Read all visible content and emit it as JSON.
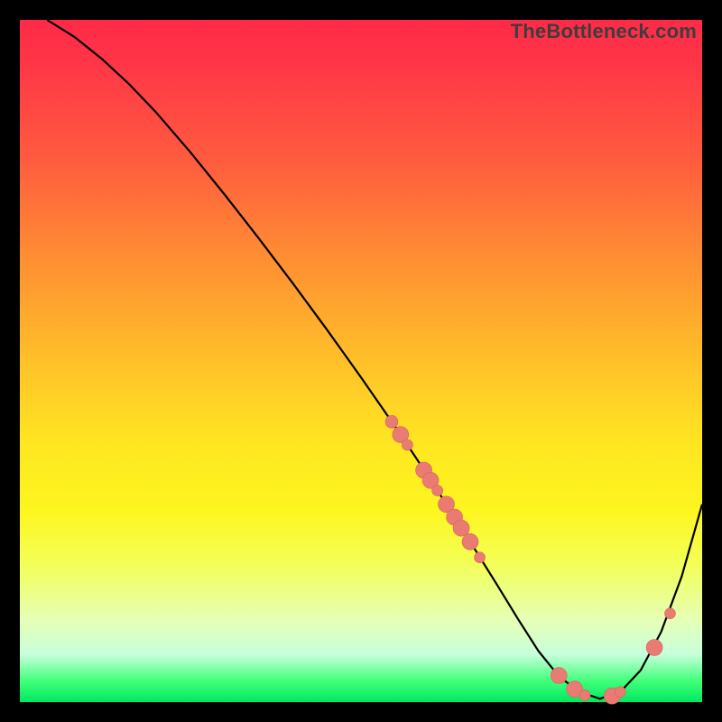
{
  "watermark": "TheBottleneck.com",
  "colors": {
    "gradient_top": "#ff2a47",
    "gradient_bottom": "#00e860",
    "curve": "#000000",
    "dot": "#e97b72"
  },
  "chart_data": {
    "type": "line",
    "title": "",
    "xlabel": "",
    "ylabel": "",
    "xlim": [
      0,
      100
    ],
    "ylim": [
      0,
      100
    ],
    "grid": false,
    "series": [
      {
        "name": "curve",
        "x": [
          4,
          8,
          12,
          16,
          20,
          25,
          30,
          35,
          40,
          45,
          50,
          55,
          58,
          62,
          66,
          70,
          73,
          76,
          79,
          82,
          85,
          88,
          91,
          94,
          97,
          100
        ],
        "y": [
          100,
          97.5,
          94.3,
          90.6,
          86.4,
          80.6,
          74.4,
          68.0,
          61.4,
          54.6,
          47.6,
          40.4,
          35.9,
          29.8,
          23.5,
          17.1,
          12.2,
          7.5,
          3.8,
          1.5,
          0.5,
          1.5,
          4.7,
          10.3,
          18.4,
          29.0
        ]
      }
    ],
    "points": [
      {
        "x": 54.5,
        "y": 41.1,
        "r": 7
      },
      {
        "x": 55.8,
        "y": 39.2,
        "r": 9
      },
      {
        "x": 56.8,
        "y": 37.7,
        "r": 6
      },
      {
        "x": 59.2,
        "y": 34.0,
        "r": 9
      },
      {
        "x": 60.2,
        "y": 32.5,
        "r": 9
      },
      {
        "x": 61.2,
        "y": 31.0,
        "r": 6
      },
      {
        "x": 62.5,
        "y": 29.0,
        "r": 9
      },
      {
        "x": 63.7,
        "y": 27.1,
        "r": 9
      },
      {
        "x": 64.7,
        "y": 25.5,
        "r": 9
      },
      {
        "x": 66.0,
        "y": 23.5,
        "r": 9
      },
      {
        "x": 67.4,
        "y": 21.2,
        "r": 6
      },
      {
        "x": 79.0,
        "y": 3.9,
        "r": 9
      },
      {
        "x": 81.3,
        "y": 1.9,
        "r": 9
      },
      {
        "x": 82.8,
        "y": 1.0,
        "r": 6
      },
      {
        "x": 86.8,
        "y": 0.9,
        "r": 9
      },
      {
        "x": 88.0,
        "y": 1.5,
        "r": 6
      },
      {
        "x": 93.0,
        "y": 8.0,
        "r": 9
      },
      {
        "x": 95.3,
        "y": 13.0,
        "r": 6
      }
    ]
  }
}
